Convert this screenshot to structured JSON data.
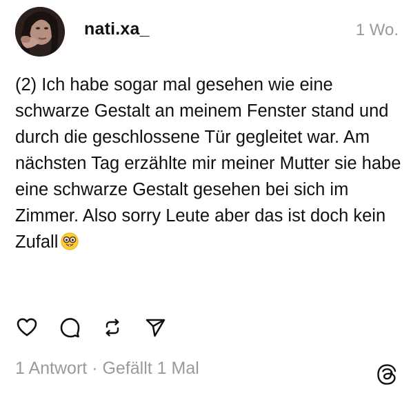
{
  "post": {
    "username": "nati.xa_",
    "timestamp": "1 Wo.",
    "text": "(2) Ich habe sogar mal gesehen wie eine schwarze Gestalt an meinem Fenster stand und durch die geschlossene Tür gegleitet war. Am nächsten Tag erzählte mir meiner Mutter sie habe eine schwarze Gestalt gesehen bei sich im Zimmer. Also sorry Leute aber das ist doch kein Zufall",
    "emoji": "nerd-face-emoji"
  },
  "actions": {
    "like_icon": "heart-icon",
    "reply_icon": "comment-icon",
    "repost_icon": "repost-icon",
    "share_icon": "send-icon"
  },
  "stats": {
    "replies": "1 Antwort",
    "separator": "·",
    "likes": "Gefällt 1 Mal"
  },
  "brand": {
    "logo_icon": "threads-logo-icon"
  },
  "colors": {
    "text": "#101010",
    "muted": "#9a9a9a",
    "background": "#ffffff"
  }
}
